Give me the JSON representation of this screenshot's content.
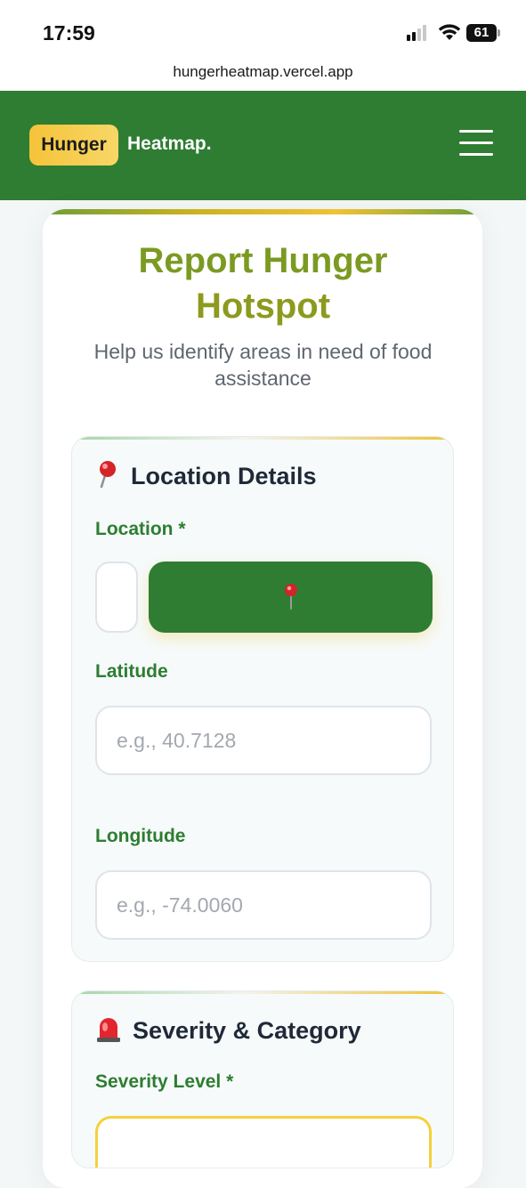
{
  "status_bar": {
    "time": "17:59",
    "battery": "61"
  },
  "browser": {
    "url": "hungerheatmap.vercel.app"
  },
  "header": {
    "logo_badge": "Hunger",
    "logo_text": "Heatmap.",
    "menu_icon": "hamburger-menu-icon",
    "background_color": "#2e7d32"
  },
  "page": {
    "title_line1": "Report Hunger",
    "title_line2": "Hotspot",
    "subtitle": "Help us identify areas in need of food assistance"
  },
  "location_section": {
    "icon": "pushpin-icon",
    "title": "Location Details",
    "location_label": "Location *",
    "locate_button_icon": "pushpin-icon",
    "latitude_label": "Latitude",
    "latitude_placeholder": "e.g., 40.7128",
    "longitude_label": "Longitude",
    "longitude_placeholder": "e.g., -74.0060"
  },
  "severity_section": {
    "icon": "siren-icon",
    "title": "Severity & Category",
    "severity_label": "Severity Level *"
  },
  "colors": {
    "brand_green": "#2e7d32",
    "brand_yellow": "#f1c232",
    "label_green": "#2e7d32"
  }
}
